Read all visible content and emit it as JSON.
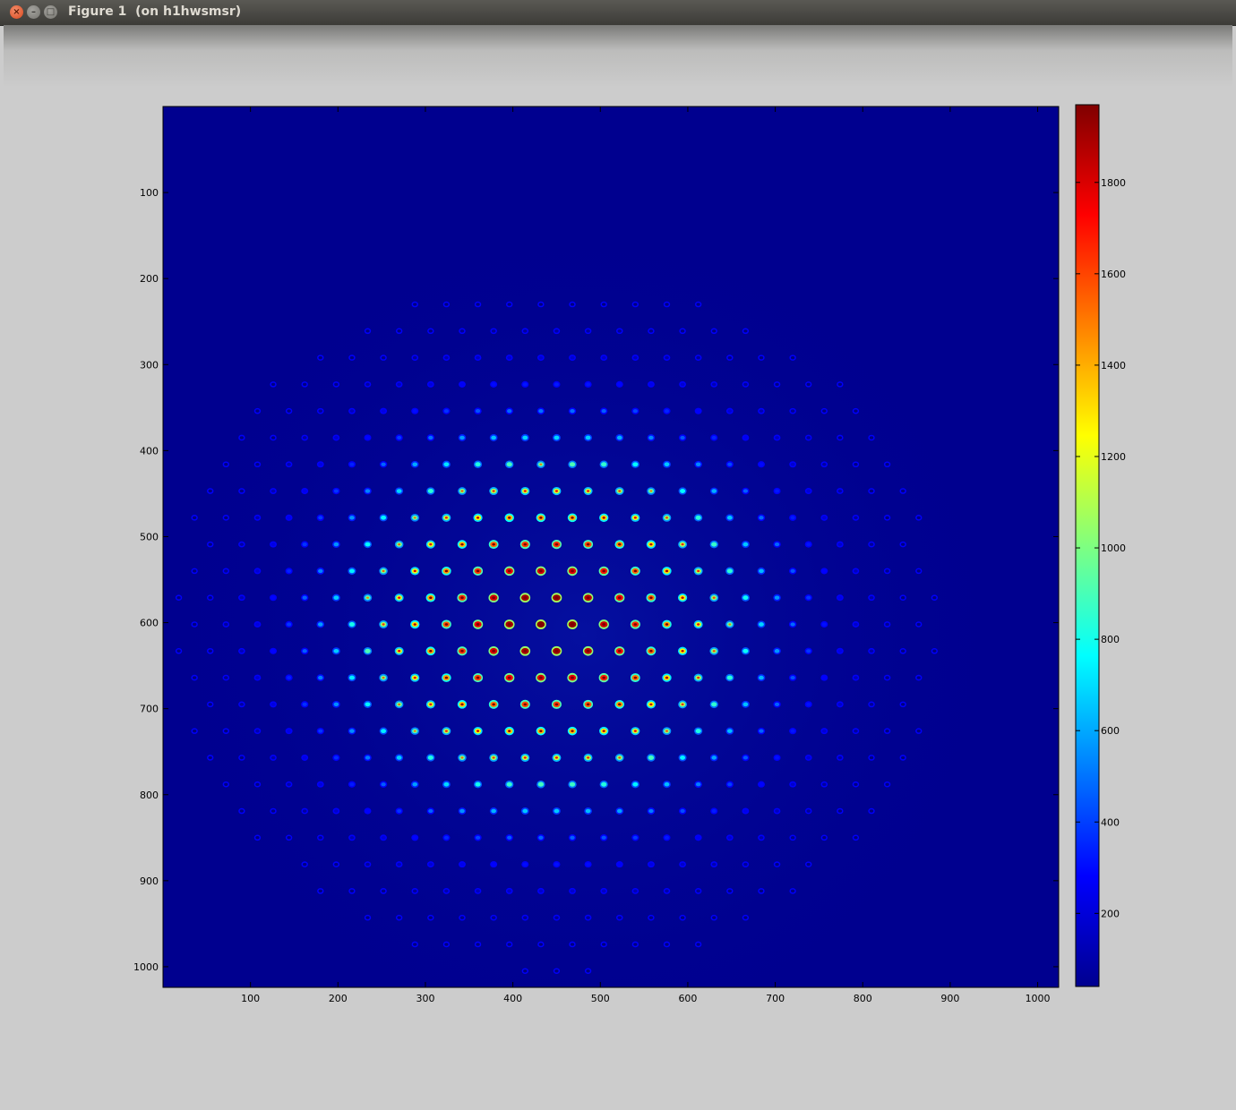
{
  "window": {
    "title": "Figure 1  (on h1hwsmsr)",
    "buttons": [
      "close",
      "minimize",
      "maximize"
    ]
  },
  "chart_data": {
    "type": "heatmap",
    "colormap": "jet",
    "background_color": "#00008f",
    "x_ticks": [
      100,
      200,
      300,
      400,
      500,
      600,
      700,
      800,
      900,
      1000
    ],
    "y_ticks": [
      100,
      200,
      300,
      400,
      500,
      600,
      700,
      800,
      900,
      1000
    ],
    "xlim": [
      0,
      1024
    ],
    "ylim": [
      0,
      1024
    ],
    "y_axis_reversed": true,
    "colorbar": {
      "ticks": [
        200,
        400,
        600,
        800,
        1000,
        1200,
        1400,
        1600,
        1800
      ],
      "range": [
        40,
        1970
      ]
    },
    "spot_grid": {
      "description_values": "hexagonal lattice of Hartmann-type spots",
      "row_spacing_y": 31,
      "col_spacing_x": 36,
      "first_row_y": 230,
      "last_row_y": 1010,
      "peak_value": 1960,
      "peak_center": [
        440,
        600
      ]
    }
  }
}
